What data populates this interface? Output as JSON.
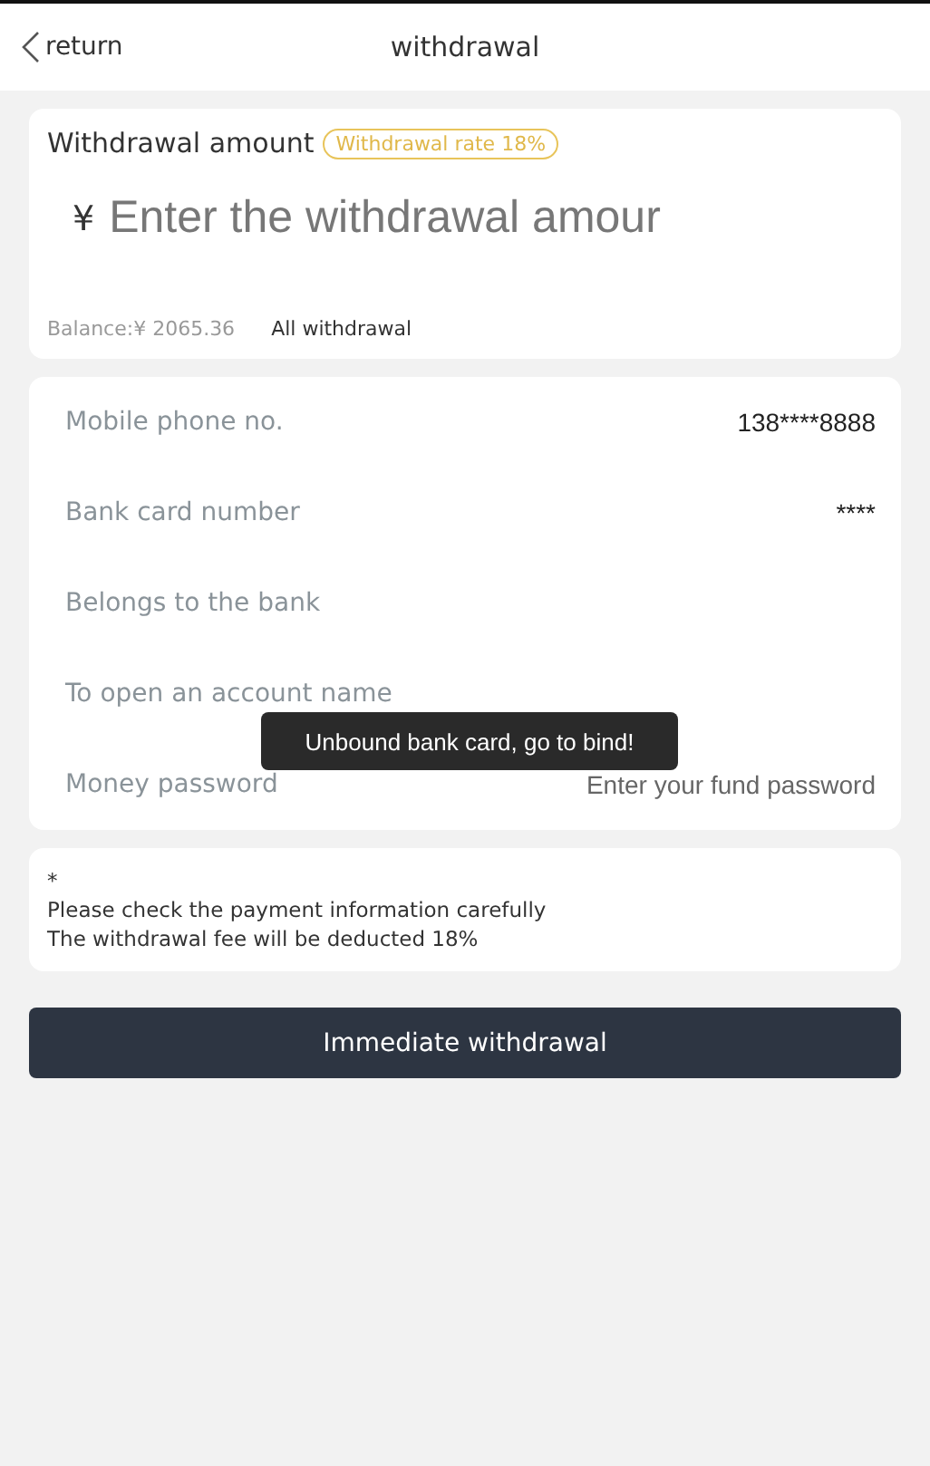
{
  "header": {
    "back_label": "return",
    "title": "withdrawal"
  },
  "amount_card": {
    "label": "Withdrawal amount",
    "rate_badge": "Withdrawal rate 18%",
    "currency": "¥",
    "placeholder": "Enter the withdrawal amour",
    "balance": "Balance:¥ 2065.36",
    "all_link": "All withdrawal"
  },
  "info_rows": [
    {
      "label": "Mobile phone no.",
      "kind": "value",
      "value": "138****8888"
    },
    {
      "label": "Bank card number",
      "kind": "value",
      "value": "****"
    },
    {
      "label": "Belongs to the bank",
      "kind": "value"
    },
    {
      "label": "To open an account name",
      "kind": "value"
    },
    {
      "label": "Money password",
      "kind": "password",
      "placeholder": "Enter your fund password"
    }
  ],
  "notice": {
    "mark": "*",
    "lines": [
      "Please check the payment information carefully",
      "The withdrawal fee will be deducted 18%"
    ]
  },
  "submit_button": "Immediate withdrawal",
  "toast": "Unbound bank card, go to bind!"
}
